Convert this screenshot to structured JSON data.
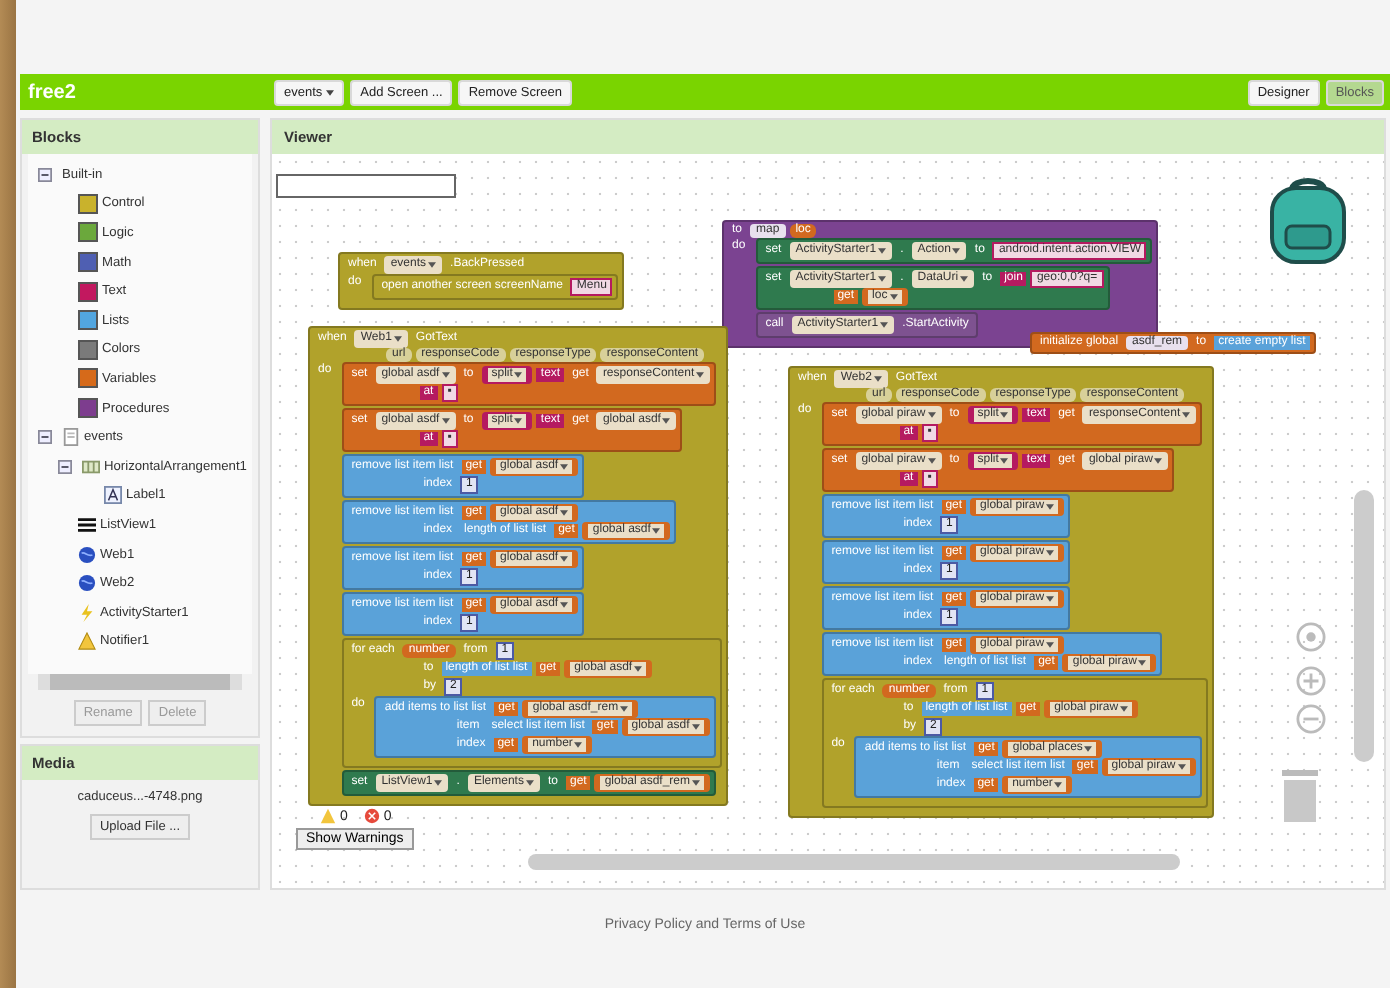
{
  "app_bar": {
    "title": "free2",
    "screen_menu": "events",
    "buttons": [
      {
        "label": "Add Screen ..."
      },
      {
        "label": "Remove Screen"
      }
    ],
    "modes": [
      {
        "label": "Designer",
        "selected": false
      },
      {
        "label": "Blocks",
        "selected": true
      }
    ]
  },
  "blocks_panel": {
    "title": "Blocks",
    "tree": [
      {
        "label": "Built-in",
        "kind": "group",
        "expanded": true,
        "children": [
          {
            "label": "Control",
            "color": "#c9b22c"
          },
          {
            "label": "Logic",
            "color": "#6ba83c"
          },
          {
            "label": "Math",
            "color": "#4f5fb2"
          },
          {
            "label": "Text",
            "color": "#c2185f"
          },
          {
            "label": "Lists",
            "color": "#52a6e0"
          },
          {
            "label": "Colors",
            "color": "#7a7a7a"
          },
          {
            "label": "Variables",
            "color": "#d66a1a"
          },
          {
            "label": "Procedures",
            "color": "#7d3d8e"
          }
        ]
      },
      {
        "label": "events",
        "kind": "screen",
        "expanded": true,
        "children": [
          {
            "label": "HorizontalArrangement1",
            "kind": "arrangement",
            "expanded": true,
            "children": [
              {
                "label": "Label1",
                "kind": "label"
              }
            ]
          },
          {
            "label": "ListView1",
            "kind": "listview"
          },
          {
            "label": "Web1",
            "kind": "web"
          },
          {
            "label": "Web2",
            "kind": "web"
          },
          {
            "label": "ActivityStarter1",
            "kind": "activity"
          },
          {
            "label": "Notifier1",
            "kind": "notifier"
          }
        ]
      }
    ],
    "buttons": [
      {
        "label": "Rename"
      },
      {
        "label": "Delete"
      }
    ]
  },
  "media_panel": {
    "title": "Media",
    "file": "caduceus...-4748.png",
    "upload_button": "Upload File ..."
  },
  "viewer": {
    "title": "Viewer",
    "blocks": [
      {
        "color": "#b1a22b",
        "lines": [
          {
            "parts": [
              {
                "kind": "label",
                "text": "when"
              },
              {
                "kind": "field",
                "text": "events"
              },
              {
                "kind": "label",
                "text": ".BackPressed"
              }
            ]
          }
        ],
        "body_label": "do",
        "body": [
          {
            "color": "#b1a22b",
            "lines": [
              {
                "parts": [
                  {
                    "kind": "label",
                    "text": "open another screen  screenName"
                  },
                  {
                    "kind": "string",
                    "text": "Menu"
                  }
                ]
              }
            ]
          }
        ]
      },
      {
        "color": "#7b4391",
        "lines": [
          {
            "parts": [
              {
                "kind": "label",
                "text": "to"
              },
              {
                "kind": "name",
                "text": "map"
              },
              {
                "kind": "param",
                "text": "loc",
                "color": "#d2691f"
              }
            ]
          }
        ],
        "body_label": "do",
        "body": [
          {
            "color": "#2f7a4e",
            "lines": [
              {
                "parts": [
                  {
                    "kind": "label",
                    "text": "set"
                  },
                  {
                    "kind": "field",
                    "text": "ActivityStarter1"
                  },
                  {
                    "kind": "label",
                    "text": "."
                  },
                  {
                    "kind": "field",
                    "text": "Action"
                  },
                  {
                    "kind": "label",
                    "text": "to"
                  },
                  {
                    "kind": "string",
                    "text": "android.intent.action.VIEW"
                  }
                ]
              }
            ]
          },
          {
            "color": "#2f7a4e",
            "lines": [
              {
                "parts": [
                  {
                    "kind": "label",
                    "text": "set"
                  },
                  {
                    "kind": "field",
                    "text": "ActivityStarter1"
                  },
                  {
                    "kind": "label",
                    "text": "."
                  },
                  {
                    "kind": "field",
                    "text": "DataUri"
                  },
                  {
                    "kind": "label",
                    "text": "to"
                  },
                  {
                    "kind": "label",
                    "text": "join",
                    "color": "#b51a60"
                  },
                  {
                    "kind": "string",
                    "text": "geo:0,0?q="
                  }
                ]
              },
              {
                "parts": [
                  {
                    "kind": "label",
                    "text": "get",
                    "color": "#d2691f"
                  },
                  {
                    "kind": "field",
                    "text": "loc",
                    "color": "#d2691f"
                  }
                ]
              }
            ]
          },
          {
            "color": "#7e5290",
            "lines": [
              {
                "parts": [
                  {
                    "kind": "label",
                    "text": "call"
                  },
                  {
                    "kind": "field",
                    "text": "ActivityStarter1"
                  },
                  {
                    "kind": "label",
                    "text": ".StartActivity"
                  }
                ]
              }
            ]
          }
        ]
      },
      {
        "color": "#b1a22b",
        "lines": [
          {
            "parts": [
              {
                "kind": "label",
                "text": "when"
              },
              {
                "kind": "field",
                "text": "Web1"
              },
              {
                "kind": "label",
                "text": "GotText"
              }
            ]
          },
          {
            "parts": [
              {
                "kind": "param",
                "text": "url"
              },
              {
                "kind": "param",
                "text": "responseCode"
              },
              {
                "kind": "param",
                "text": "responseType"
              },
              {
                "kind": "param",
                "text": "responseContent"
              }
            ]
          }
        ],
        "body_label": "do",
        "body": [
          {
            "color": "#d2691f",
            "lines": [
              {
                "parts": [
                  {
                    "kind": "label",
                    "text": "set"
                  },
                  {
                    "kind": "field",
                    "text": "global asdf"
                  },
                  {
                    "kind": "label",
                    "text": "to"
                  },
                  {
                    "kind": "field",
                    "text": "split",
                    "color": "#b51a60"
                  },
                  {
                    "kind": "label",
                    "text": "text",
                    "color": "#b51a60"
                  },
                  {
                    "kind": "label",
                    "text": "get",
                    "color": "#d2691f"
                  },
                  {
                    "kind": "field",
                    "text": "responseContent"
                  }
                ]
              },
              {
                "parts": [
                  {
                    "kind": "label",
                    "text": "at",
                    "color": "#b51a60"
                  },
                  {
                    "kind": "string",
                    "text": "▪"
                  }
                ]
              }
            ]
          },
          {
            "color": "#d2691f",
            "lines": [
              {
                "parts": [
                  {
                    "kind": "label",
                    "text": "set"
                  },
                  {
                    "kind": "field",
                    "text": "global asdf"
                  },
                  {
                    "kind": "label",
                    "text": "to"
                  },
                  {
                    "kind": "field",
                    "text": "split",
                    "color": "#b51a60"
                  },
                  {
                    "kind": "label",
                    "text": "text",
                    "color": "#b51a60"
                  },
                  {
                    "kind": "label",
                    "text": "get",
                    "color": "#d2691f"
                  },
                  {
                    "kind": "field",
                    "text": "global asdf"
                  }
                ]
              },
              {
                "parts": [
                  {
                    "kind": "label",
                    "text": "at",
                    "color": "#b51a60"
                  },
                  {
                    "kind": "string",
                    "text": "▪"
                  }
                ]
              }
            ]
          },
          {
            "color": "#5aa2d9",
            "lines": [
              {
                "parts": [
                  {
                    "kind": "label",
                    "text": "remove list item  list"
                  },
                  {
                    "kind": "label",
                    "text": "get",
                    "color": "#d2691f"
                  },
                  {
                    "kind": "field",
                    "text": "global asdf",
                    "color": "#d2691f"
                  }
                ]
              },
              {
                "parts": [
                  {
                    "kind": "label",
                    "text": "index"
                  },
                  {
                    "kind": "number",
                    "text": "1"
                  }
                ]
              }
            ]
          },
          {
            "color": "#5aa2d9",
            "lines": [
              {
                "parts": [
                  {
                    "kind": "label",
                    "text": "remove list item  list"
                  },
                  {
                    "kind": "label",
                    "text": "get",
                    "color": "#d2691f"
                  },
                  {
                    "kind": "field",
                    "text": "global asdf",
                    "color": "#d2691f"
                  }
                ]
              },
              {
                "parts": [
                  {
                    "kind": "label",
                    "text": "index"
                  },
                  {
                    "kind": "label",
                    "text": "length of list  list"
                  },
                  {
                    "kind": "label",
                    "text": "get",
                    "color": "#d2691f"
                  },
                  {
                    "kind": "field",
                    "text": "global asdf",
                    "color": "#d2691f"
                  }
                ]
              }
            ]
          },
          {
            "color": "#5aa2d9",
            "lines": [
              {
                "parts": [
                  {
                    "kind": "label",
                    "text": "remove list item  list"
                  },
                  {
                    "kind": "label",
                    "text": "get",
                    "color": "#d2691f"
                  },
                  {
                    "kind": "field",
                    "text": "global asdf",
                    "color": "#d2691f"
                  }
                ]
              },
              {
                "parts": [
                  {
                    "kind": "label",
                    "text": "index"
                  },
                  {
                    "kind": "number",
                    "text": "1"
                  }
                ]
              }
            ]
          },
          {
            "color": "#5aa2d9",
            "lines": [
              {
                "parts": [
                  {
                    "kind": "label",
                    "text": "remove list item  list"
                  },
                  {
                    "kind": "label",
                    "text": "get",
                    "color": "#d2691f"
                  },
                  {
                    "kind": "field",
                    "text": "global asdf",
                    "color": "#d2691f"
                  }
                ]
              },
              {
                "parts": [
                  {
                    "kind": "label",
                    "text": "index"
                  },
                  {
                    "kind": "number",
                    "text": "1"
                  }
                ]
              }
            ]
          },
          {
            "color": "#b1a22b",
            "lines": [
              {
                "parts": [
                  {
                    "kind": "label",
                    "text": "for each"
                  },
                  {
                    "kind": "param",
                    "text": "number",
                    "color": "#d2691f"
                  },
                  {
                    "kind": "label",
                    "text": "from"
                  },
                  {
                    "kind": "number",
                    "text": "1"
                  }
                ]
              },
              {
                "parts": [
                  {
                    "kind": "label",
                    "text": "to"
                  },
                  {
                    "kind": "label",
                    "text": "length of list  list",
                    "color": "#5aa2d9"
                  },
                  {
                    "kind": "label",
                    "text": "get",
                    "color": "#d2691f"
                  },
                  {
                    "kind": "field",
                    "text": "global asdf",
                    "color": "#d2691f"
                  }
                ]
              },
              {
                "parts": [
                  {
                    "kind": "label",
                    "text": "by"
                  },
                  {
                    "kind": "number",
                    "text": "2"
                  }
                ]
              }
            ],
            "body_label": "do",
            "body": [
              {
                "color": "#5aa2d9",
                "lines": [
                  {
                    "parts": [
                      {
                        "kind": "label",
                        "text": "add items to list  list"
                      },
                      {
                        "kind": "label",
                        "text": "get",
                        "color": "#d2691f"
                      },
                      {
                        "kind": "field",
                        "text": "global asdf_rem",
                        "color": "#d2691f"
                      }
                    ]
                  },
                  {
                    "parts": [
                      {
                        "kind": "label",
                        "text": "item"
                      },
                      {
                        "kind": "label",
                        "text": "select list item  list"
                      },
                      {
                        "kind": "label",
                        "text": "get",
                        "color": "#d2691f"
                      },
                      {
                        "kind": "field",
                        "text": "global asdf",
                        "color": "#d2691f"
                      }
                    ]
                  },
                  {
                    "parts": [
                      {
                        "kind": "label",
                        "text": "index"
                      },
                      {
                        "kind": "label",
                        "text": "get",
                        "color": "#d2691f"
                      },
                      {
                        "kind": "field",
                        "text": "number",
                        "color": "#d2691f"
                      }
                    ]
                  }
                ]
              }
            ]
          },
          {
            "color": "#2f7a4e",
            "lines": [
              {
                "parts": [
                  {
                    "kind": "label",
                    "text": "set"
                  },
                  {
                    "kind": "field",
                    "text": "ListView1"
                  },
                  {
                    "kind": "label",
                    "text": "."
                  },
                  {
                    "kind": "field",
                    "text": "Elements"
                  },
                  {
                    "kind": "label",
                    "text": "to"
                  },
                  {
                    "kind": "label",
                    "text": "get",
                    "color": "#d2691f"
                  },
                  {
                    "kind": "field",
                    "text": "global asdf_rem",
                    "color": "#d2691f"
                  }
                ]
              }
            ]
          }
        ]
      },
      {
        "color": "#d2691f",
        "lines": [
          {
            "parts": [
              {
                "kind": "label",
                "text": "initialize global"
              },
              {
                "kind": "name",
                "text": "asdf_rem"
              },
              {
                "kind": "label",
                "text": "to"
              },
              {
                "kind": "label",
                "text": "create empty list",
                "color": "#5aa2d9"
              }
            ]
          }
        ]
      },
      {
        "color": "#b1a22b",
        "lines": [
          {
            "parts": [
              {
                "kind": "label",
                "text": "when"
              },
              {
                "kind": "field",
                "text": "Web2"
              },
              {
                "kind": "label",
                "text": "GotText"
              }
            ]
          },
          {
            "parts": [
              {
                "kind": "param",
                "text": "url"
              },
              {
                "kind": "param",
                "text": "responseCode"
              },
              {
                "kind": "param",
                "text": "responseType"
              },
              {
                "kind": "param",
                "text": "responseContent"
              }
            ]
          }
        ],
        "body_label": "do",
        "body": [
          {
            "color": "#d2691f",
            "lines": [
              {
                "parts": [
                  {
                    "kind": "label",
                    "text": "set"
                  },
                  {
                    "kind": "field",
                    "text": "global piraw"
                  },
                  {
                    "kind": "label",
                    "text": "to"
                  },
                  {
                    "kind": "field",
                    "text": "split",
                    "color": "#b51a60"
                  },
                  {
                    "kind": "label",
                    "text": "text",
                    "color": "#b51a60"
                  },
                  {
                    "kind": "label",
                    "text": "get",
                    "color": "#d2691f"
                  },
                  {
                    "kind": "field",
                    "text": "responseContent"
                  }
                ]
              },
              {
                "parts": [
                  {
                    "kind": "label",
                    "text": "at",
                    "color": "#b51a60"
                  },
                  {
                    "kind": "string",
                    "text": "▪"
                  }
                ]
              }
            ]
          },
          {
            "color": "#d2691f",
            "lines": [
              {
                "parts": [
                  {
                    "kind": "label",
                    "text": "set"
                  },
                  {
                    "kind": "field",
                    "text": "global piraw"
                  },
                  {
                    "kind": "label",
                    "text": "to"
                  },
                  {
                    "kind": "field",
                    "text": "split",
                    "color": "#b51a60"
                  },
                  {
                    "kind": "label",
                    "text": "text",
                    "color": "#b51a60"
                  },
                  {
                    "kind": "label",
                    "text": "get",
                    "color": "#d2691f"
                  },
                  {
                    "kind": "field",
                    "text": "global piraw"
                  }
                ]
              },
              {
                "parts": [
                  {
                    "kind": "label",
                    "text": "at",
                    "color": "#b51a60"
                  },
                  {
                    "kind": "string",
                    "text": "▪"
                  }
                ]
              }
            ]
          },
          {
            "color": "#5aa2d9",
            "lines": [
              {
                "parts": [
                  {
                    "kind": "label",
                    "text": "remove list item  list"
                  },
                  {
                    "kind": "label",
                    "text": "get",
                    "color": "#d2691f"
                  },
                  {
                    "kind": "field",
                    "text": "global piraw",
                    "color": "#d2691f"
                  }
                ]
              },
              {
                "parts": [
                  {
                    "kind": "label",
                    "text": "index"
                  },
                  {
                    "kind": "number",
                    "text": "1"
                  }
                ]
              }
            ]
          },
          {
            "color": "#5aa2d9",
            "lines": [
              {
                "parts": [
                  {
                    "kind": "label",
                    "text": "remove list item  list"
                  },
                  {
                    "kind": "label",
                    "text": "get",
                    "color": "#d2691f"
                  },
                  {
                    "kind": "field",
                    "text": "global piraw",
                    "color": "#d2691f"
                  }
                ]
              },
              {
                "parts": [
                  {
                    "kind": "label",
                    "text": "index"
                  },
                  {
                    "kind": "number",
                    "text": "1"
                  }
                ]
              }
            ]
          },
          {
            "color": "#5aa2d9",
            "lines": [
              {
                "parts": [
                  {
                    "kind": "label",
                    "text": "remove list item  list"
                  },
                  {
                    "kind": "label",
                    "text": "get",
                    "color": "#d2691f"
                  },
                  {
                    "kind": "field",
                    "text": "global piraw",
                    "color": "#d2691f"
                  }
                ]
              },
              {
                "parts": [
                  {
                    "kind": "label",
                    "text": "index"
                  },
                  {
                    "kind": "number",
                    "text": "1"
                  }
                ]
              }
            ]
          },
          {
            "color": "#5aa2d9",
            "lines": [
              {
                "parts": [
                  {
                    "kind": "label",
                    "text": "remove list item  list"
                  },
                  {
                    "kind": "label",
                    "text": "get",
                    "color": "#d2691f"
                  },
                  {
                    "kind": "field",
                    "text": "global piraw",
                    "color": "#d2691f"
                  }
                ]
              },
              {
                "parts": [
                  {
                    "kind": "label",
                    "text": "index"
                  },
                  {
                    "kind": "label",
                    "text": "length of list  list"
                  },
                  {
                    "kind": "label",
                    "text": "get",
                    "color": "#d2691f"
                  },
                  {
                    "kind": "field",
                    "text": "global piraw",
                    "color": "#d2691f"
                  }
                ]
              }
            ]
          },
          {
            "color": "#b1a22b",
            "lines": [
              {
                "parts": [
                  {
                    "kind": "label",
                    "text": "for each"
                  },
                  {
                    "kind": "param",
                    "text": "number",
                    "color": "#d2691f"
                  },
                  {
                    "kind": "label",
                    "text": "from"
                  },
                  {
                    "kind": "number",
                    "text": "1"
                  }
                ]
              },
              {
                "parts": [
                  {
                    "kind": "label",
                    "text": "to"
                  },
                  {
                    "kind": "label",
                    "text": "length of list  list",
                    "color": "#5aa2d9"
                  },
                  {
                    "kind": "label",
                    "text": "get",
                    "color": "#d2691f"
                  },
                  {
                    "kind": "field",
                    "text": "global piraw",
                    "color": "#d2691f"
                  }
                ]
              },
              {
                "parts": [
                  {
                    "kind": "label",
                    "text": "by"
                  },
                  {
                    "kind": "number",
                    "text": "2"
                  }
                ]
              }
            ],
            "body_label": "do",
            "body": [
              {
                "color": "#5aa2d9",
                "lines": [
                  {
                    "parts": [
                      {
                        "kind": "label",
                        "text": "add items to list  list"
                      },
                      {
                        "kind": "label",
                        "text": "get",
                        "color": "#d2691f"
                      },
                      {
                        "kind": "field",
                        "text": "global places",
                        "color": "#d2691f"
                      }
                    ]
                  },
                  {
                    "parts": [
                      {
                        "kind": "label",
                        "text": "item"
                      },
                      {
                        "kind": "label",
                        "text": "select list item  list"
                      },
                      {
                        "kind": "label",
                        "text": "get",
                        "color": "#d2691f"
                      },
                      {
                        "kind": "field",
                        "text": "global piraw",
                        "color": "#d2691f"
                      }
                    ]
                  },
                  {
                    "parts": [
                      {
                        "kind": "label",
                        "text": "index"
                      },
                      {
                        "kind": "label",
                        "text": "get",
                        "color": "#d2691f"
                      },
                      {
                        "kind": "field",
                        "text": "number",
                        "color": "#d2691f"
                      }
                    ]
                  }
                ]
              }
            ]
          }
        ]
      }
    ],
    "warnings": "0",
    "errors": "0",
    "warnings_button": "Show Warnings"
  },
  "footer": {
    "link": "Privacy Policy and Terms of Use"
  }
}
